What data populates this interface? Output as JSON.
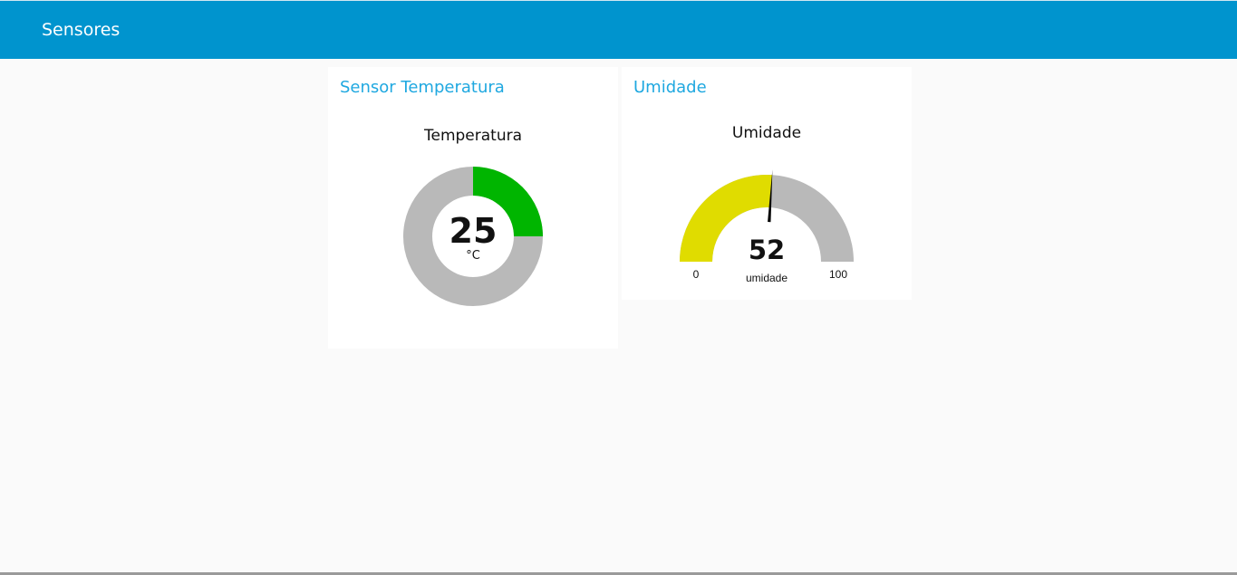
{
  "toolbar": {
    "title": "Sensores",
    "background": "#0094ce"
  },
  "cards": {
    "temperature": {
      "group_title": "Sensor Temperatura",
      "label": "Temperatura",
      "value": "25",
      "value_number": 25,
      "unit": "°C",
      "min": 0,
      "max": 100,
      "fill_color": "#00b500",
      "track_color": "#b9b9b9"
    },
    "humidity": {
      "group_title": "Umidade",
      "label": "Umidade",
      "value": "52",
      "value_number": 52,
      "unit": "umidade",
      "min_label": "0",
      "max_label": "100",
      "min": 0,
      "max": 100,
      "fill_color": "#e0dc00",
      "track_color": "#b9b9b9",
      "needle_color": "#000000"
    }
  }
}
